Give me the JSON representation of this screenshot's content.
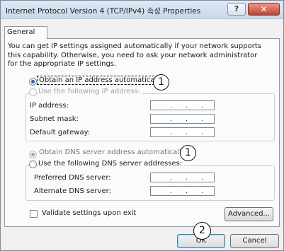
{
  "window": {
    "title": "Internet Protocol Version 4 (TCP/IPv4) 속성 Properties",
    "help_glyph": "?",
    "close_glyph": "✕"
  },
  "tabs": [
    {
      "label": "General"
    }
  ],
  "description": [
    "You can get IP settings assigned automatically if your network supports",
    "this capability. Otherwise, you need to ask your network administrator",
    "for the appropriate IP settings."
  ],
  "ip_section": {
    "auto_label": "Obtain an IP address automatically",
    "manual_label": "Use the following IP address:",
    "fields": [
      {
        "label": "IP address:",
        "value": ". . ."
      },
      {
        "label": "Subnet mask:",
        "value": ". . ."
      },
      {
        "label": "Default gateway:",
        "value": ". . ."
      }
    ]
  },
  "dns_section": {
    "auto_label": "Obtain DNS server address automatically",
    "manual_label": "Use the following DNS server addresses:",
    "fields": [
      {
        "label": "Preferred DNS server:",
        "value": ". . ."
      },
      {
        "label": "Alternate DNS server:",
        "value": ". . ."
      }
    ]
  },
  "validate_label": "Validate settings upon exit",
  "buttons": {
    "advanced": "Advanced...",
    "ok": "OK",
    "cancel": "Cancel"
  },
  "callouts": [
    "1",
    "1",
    "2"
  ]
}
